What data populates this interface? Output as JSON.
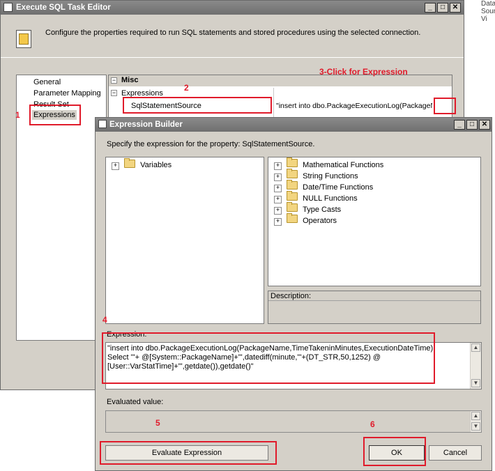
{
  "outer": {
    "title": "Execute SQL Task Editor",
    "description": "Configure the properties required to run SQL statements and stored procedures using the selected connection.",
    "nav_items": [
      "General",
      "Parameter Mapping",
      "Result Set",
      "Expressions"
    ],
    "bg_text": "Data Source Vi"
  },
  "grid": {
    "category": "Misc",
    "group": "Expressions",
    "property": "SqlStatementSource",
    "value": "\"insert into dbo.PackageExecutionLog(PackageName"
  },
  "builder": {
    "title": "Expression Builder",
    "instruction": "Specify the expression for the property: SqlStatementSource.",
    "left_tree": [
      "Variables"
    ],
    "right_tree": [
      "Mathematical Functions",
      "String Functions",
      "Date/Time Functions",
      "NULL Functions",
      "Type Casts",
      "Operators"
    ],
    "description_label": "Description:",
    "expression_label": "Expression:",
    "expression_lines": [
      "\"insert into dbo.PackageExecutionLog(PackageName,TimeTakeninMinutes,ExecutionDateTime)",
      "Select '\"+ @[System::PackageName]+\"',datediff(minute,'\"+(DT_STR,50,1252) @",
      "[User::VarStatTime]+\"',getdate()),getdate()\""
    ],
    "evaluated_label": "Evaluated value:",
    "evaluate_button": "Evaluate Expression",
    "ok_button": "OK",
    "cancel_button": "Cancel"
  },
  "annotations": {
    "n1": "1",
    "n2": "2",
    "n3": "3-Click for Expression",
    "n4": "4",
    "n5": "5",
    "n6": "6"
  },
  "window_buttons": {
    "minimize": "_",
    "maximize": "□",
    "close": "✕"
  },
  "colors": {
    "annotation": "#e01b2b",
    "window_bg": "#d4d0c8",
    "titlebar": "#7a7a7a"
  }
}
